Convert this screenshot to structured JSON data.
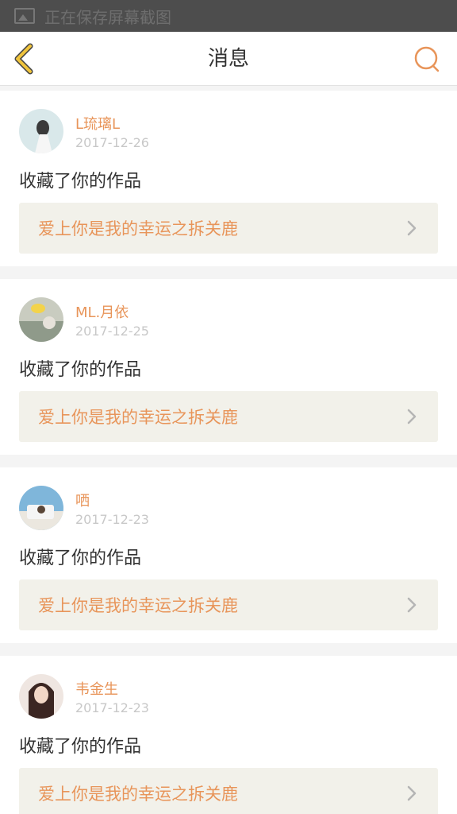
{
  "status_bar": {
    "text": "正在保存屏幕截图",
    "icon": "image-icon"
  },
  "header": {
    "title": "消息",
    "back_icon": "back-chevron-icon",
    "search_icon": "search-icon"
  },
  "colors": {
    "accent": "#e8955a",
    "back_icon": "#f0c43c",
    "card_bg": "#ffffff",
    "work_bg": "#f2f1ea"
  },
  "messages": [
    {
      "user": "L琉璃L",
      "date": "2017-12-26",
      "action": "收藏了你的作品",
      "work_title": "爱上你是我的幸运之拆关鹿"
    },
    {
      "user": "ML.月依",
      "date": "2017-12-25",
      "action": "收藏了你的作品",
      "work_title": "爱上你是我的幸运之拆关鹿"
    },
    {
      "user": "哂",
      "date": "2017-12-23",
      "action": "收藏了你的作品",
      "work_title": "爱上你是我的幸运之拆关鹿"
    },
    {
      "user": "韦金生",
      "date": "2017-12-23",
      "action": "收藏了你的作品",
      "work_title": "爱上你是我的幸运之拆关鹿"
    }
  ]
}
